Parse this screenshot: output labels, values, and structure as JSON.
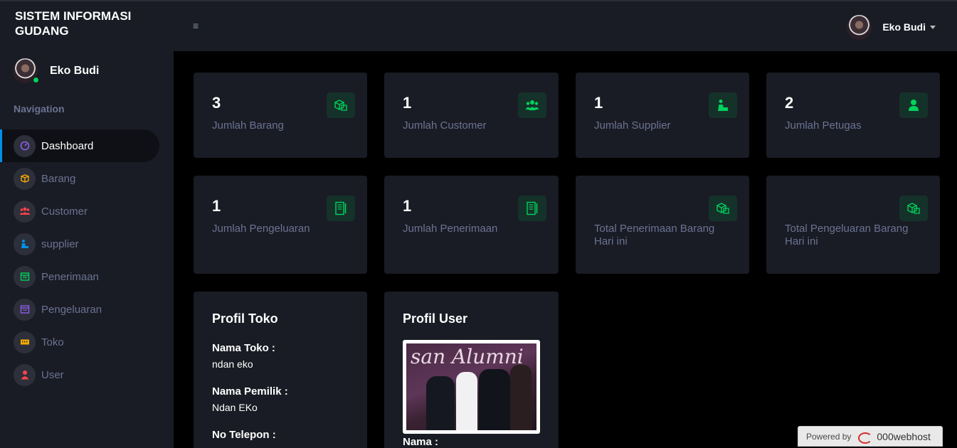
{
  "header": {
    "brand": "SISTEM INFORMASI GUDANG",
    "menu_icon": "hamburger-icon",
    "user_name": "Eko Budi"
  },
  "sidebar": {
    "user_name": "Eko Budi",
    "status_color": "#00d25b",
    "category": "Navigation",
    "items": [
      {
        "label": "Dashboard",
        "icon": "speedometer-icon",
        "color": "#8f5fe8",
        "active": true
      },
      {
        "label": "Barang",
        "icon": "box-icon",
        "color": "#ffab00"
      },
      {
        "label": "Customer",
        "icon": "users-icon",
        "color": "#fc424a"
      },
      {
        "label": "supplier",
        "icon": "worker-icon",
        "color": "#0090e7"
      },
      {
        "label": "Penerimaan",
        "icon": "inbox-icon",
        "color": "#00d25b"
      },
      {
        "label": "Pengeluaran",
        "icon": "outbox-icon",
        "color": "#8f5fe8"
      },
      {
        "label": "Toko",
        "icon": "store-icon",
        "color": "#ffab00"
      },
      {
        "label": "User",
        "icon": "user-icon",
        "color": "#fc424a"
      }
    ]
  },
  "stats": [
    {
      "value": "3",
      "label": "Jumlah Barang",
      "icon": "boxes-icon"
    },
    {
      "value": "1",
      "label": "Jumlah Customer",
      "icon": "users-icon"
    },
    {
      "value": "1",
      "label": "Jumlah Supplier",
      "icon": "worker-icon"
    },
    {
      "value": "2",
      "label": "Jumlah Petugas",
      "icon": "user-icon"
    },
    {
      "value": "1",
      "label": "Jumlah Pengeluaran",
      "icon": "receipt-icon"
    },
    {
      "value": "1",
      "label": "Jumlah Penerimaan",
      "icon": "receipt-icon"
    },
    {
      "value": "",
      "label": "Total Penerimaan Barang Hari ini",
      "icon": "boxes-icon"
    },
    {
      "value": "",
      "label": "Total Pengeluaran Barang Hari ini",
      "icon": "boxes-icon"
    }
  ],
  "accent": "#00d25b",
  "profil_toko": {
    "title": "Profil Toko",
    "nama_toko_label": "Nama Toko :",
    "nama_toko": "ndan eko",
    "nama_pemilik_label": "Nama Pemilik :",
    "nama_pemilik": "Ndan EKo",
    "telepon_label": "No Telepon :"
  },
  "profil_user": {
    "title": "Profil User",
    "photo_caption": "san Alumni",
    "nama_label": "Nama :"
  },
  "host_badge": {
    "powered_by": "Powered by",
    "brand": "000webhost"
  }
}
